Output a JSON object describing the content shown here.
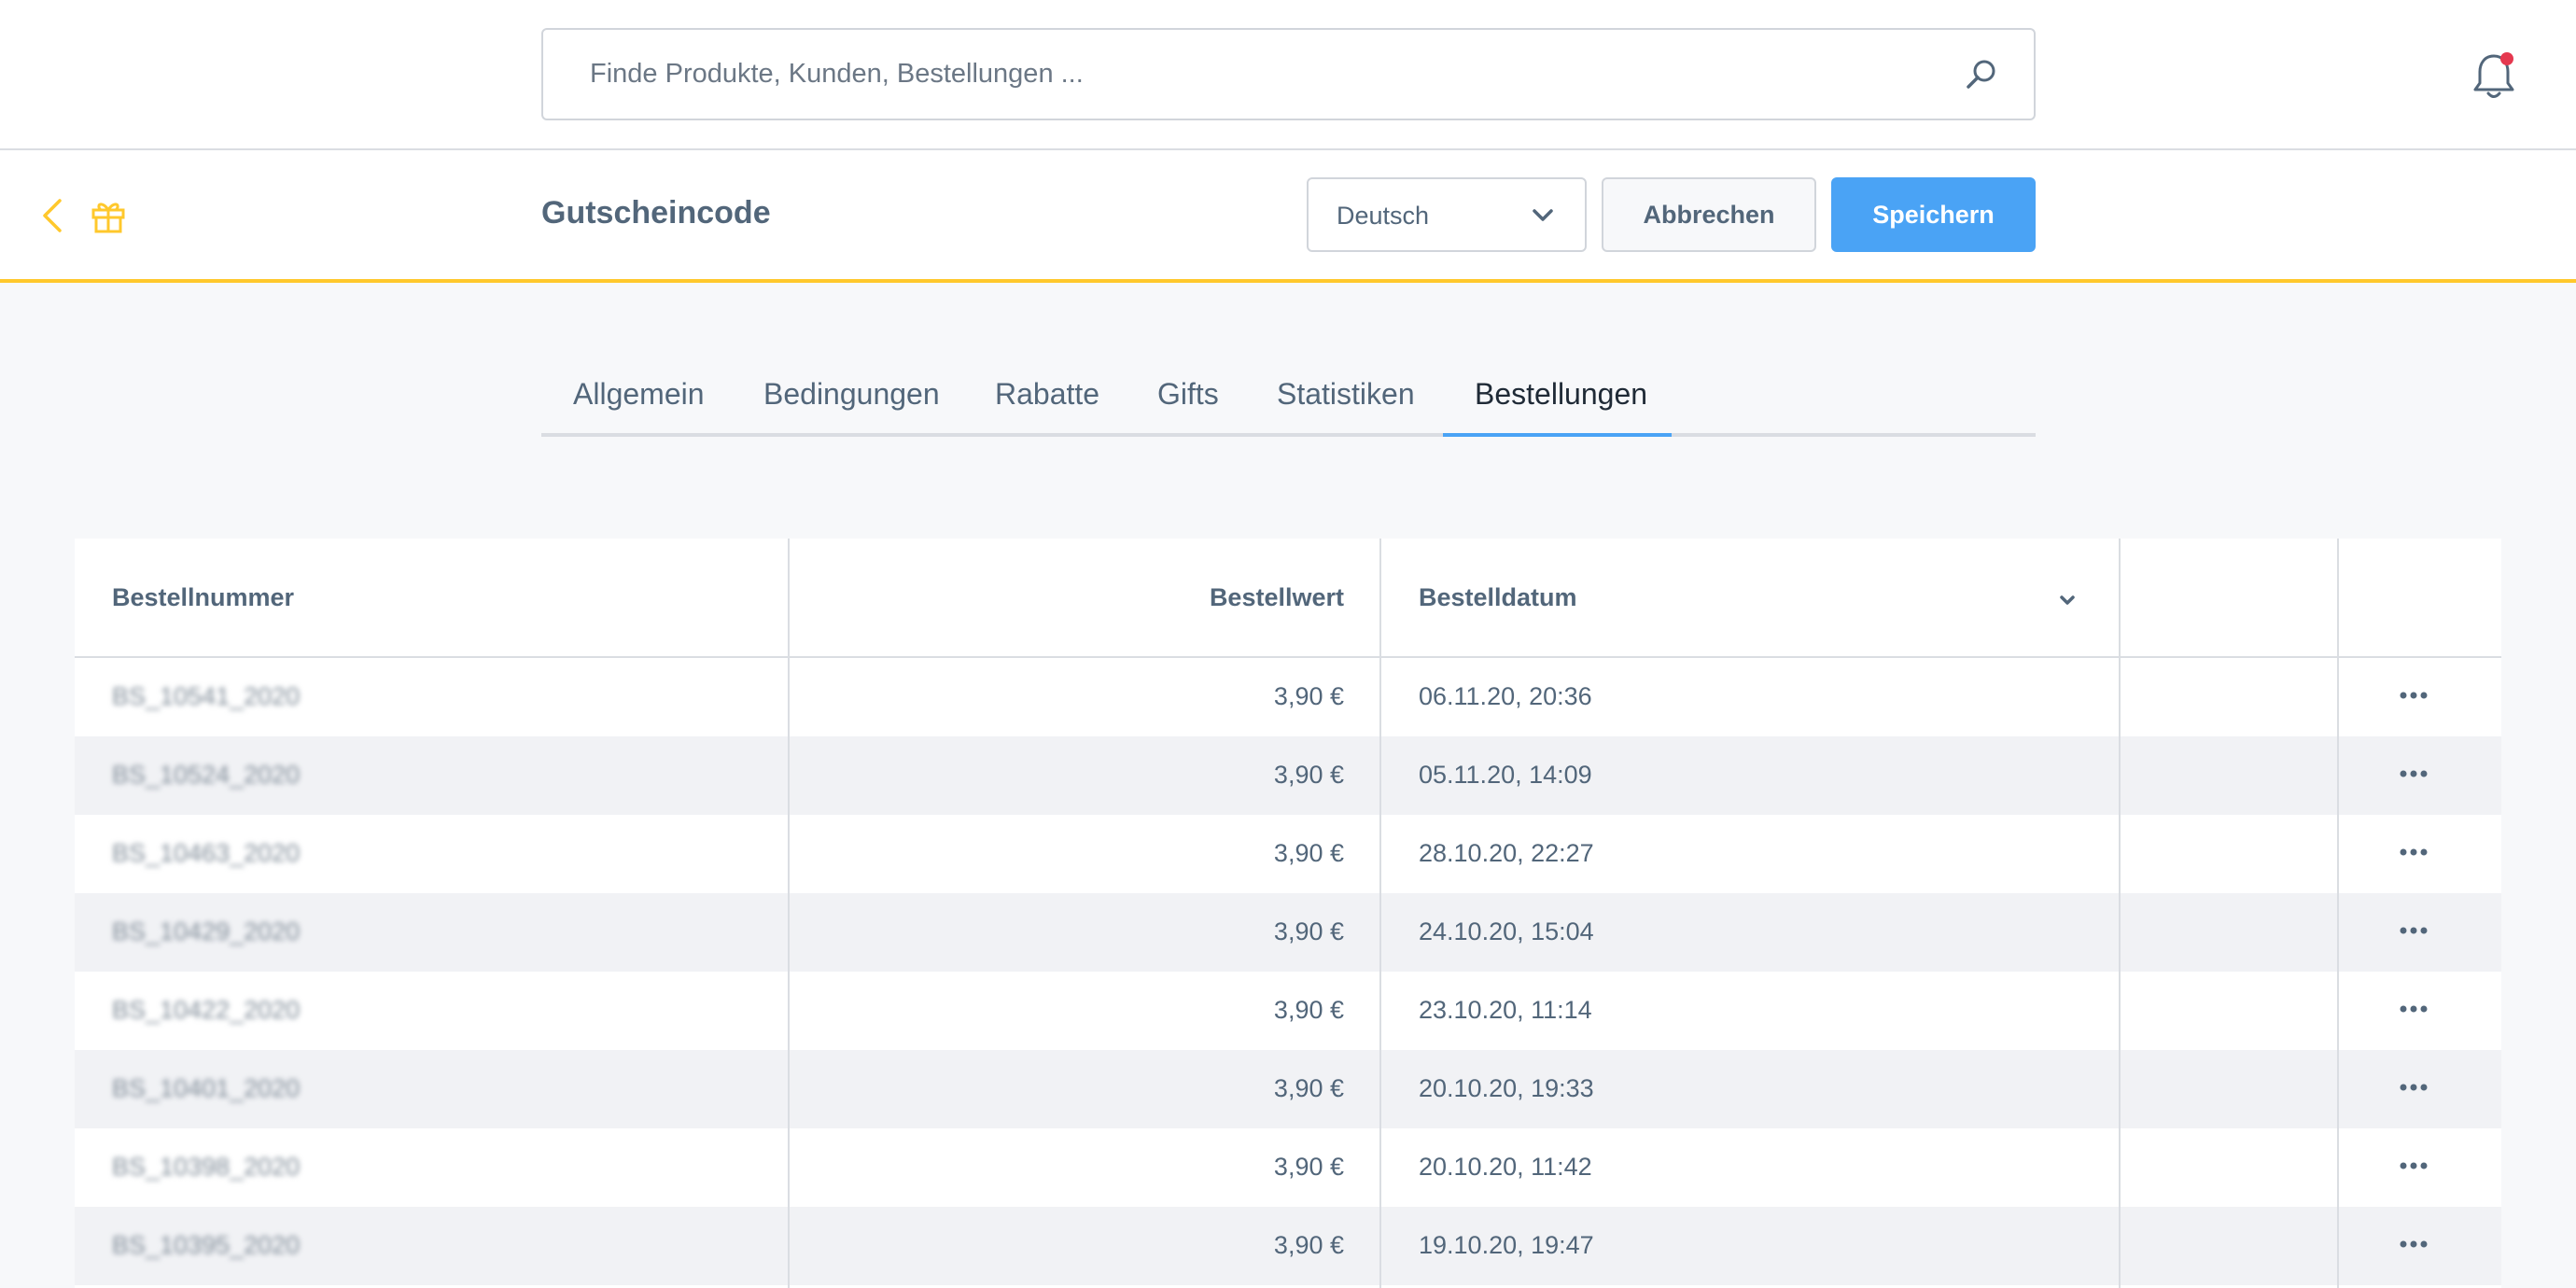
{
  "search": {
    "placeholder": "Finde Produkte, Kunden, Bestellungen ..."
  },
  "header": {
    "title": "Gutscheincode",
    "language": "Deutsch",
    "cancel_label": "Abbrechen",
    "save_label": "Speichern"
  },
  "tabs": [
    {
      "label": "Allgemein"
    },
    {
      "label": "Bedingungen"
    },
    {
      "label": "Rabatte"
    },
    {
      "label": "Gifts"
    },
    {
      "label": "Statistiken"
    },
    {
      "label": "Bestellungen",
      "active": true
    }
  ],
  "table": {
    "columns": {
      "number": "Bestellnummer",
      "value": "Bestellwert",
      "date": "Bestelldatum"
    },
    "rows": [
      {
        "number": "BS_10541_2020",
        "value": "3,90 €",
        "date": "06.11.20, 20:36"
      },
      {
        "number": "BS_10524_2020",
        "value": "3,90 €",
        "date": "05.11.20, 14:09"
      },
      {
        "number": "BS_10463_2020",
        "value": "3,90 €",
        "date": "28.10.20, 22:27"
      },
      {
        "number": "BS_10429_2020",
        "value": "3,90 €",
        "date": "24.10.20, 15:04"
      },
      {
        "number": "BS_10422_2020",
        "value": "3,90 €",
        "date": "23.10.20, 11:14"
      },
      {
        "number": "BS_10401_2020",
        "value": "3,90 €",
        "date": "20.10.20, 19:33"
      },
      {
        "number": "BS_10398_2020",
        "value": "3,90 €",
        "date": "20.10.20, 11:42"
      },
      {
        "number": "BS_10395_2020",
        "value": "3,90 €",
        "date": "19.10.20, 19:47"
      }
    ]
  },
  "colors": {
    "accent": "#4aa3f5",
    "brand_yellow": "#ffc82c",
    "notification": "#e5384f",
    "text": "#52667a"
  },
  "icons": [
    "search-icon",
    "bell-icon",
    "back-arrow-icon",
    "gift-icon",
    "chevron-down-icon",
    "sort-chevron-icon",
    "more-icon"
  ]
}
